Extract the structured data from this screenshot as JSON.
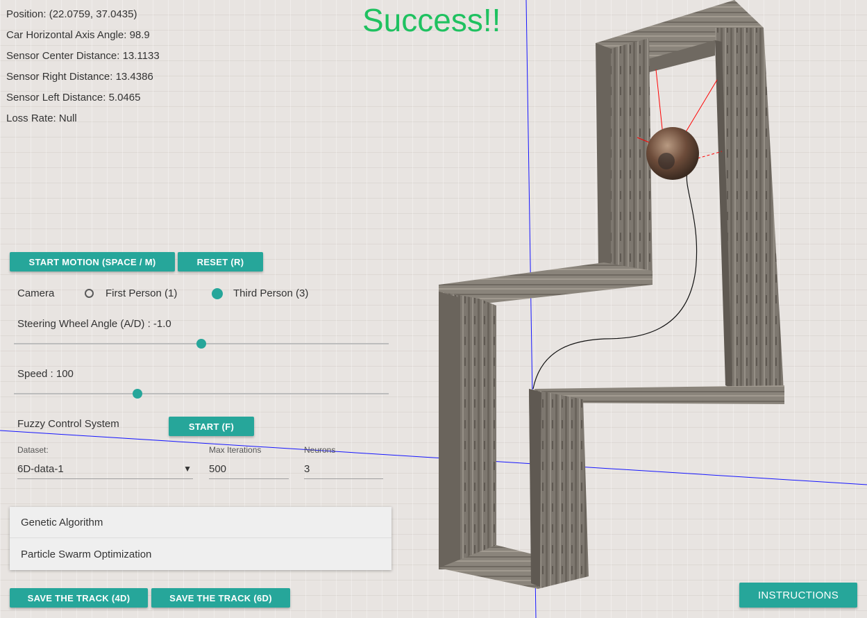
{
  "info": {
    "position": "Position: (22.0759, 37.0435)",
    "angle": "Car Horizontal Axis Angle: 98.9",
    "sensor_center": "Sensor Center Distance: 13.1133",
    "sensor_right": "Sensor Right Distance: 13.4386",
    "sensor_left": "Sensor Left Distance: 5.0465",
    "loss_rate": "Loss Rate: Null"
  },
  "status": "Success!!",
  "controls": {
    "start_motion": "START MOTION (SPACE / M)",
    "reset": "RESET (R)",
    "camera_label": "Camera",
    "camera_first": "First Person (1)",
    "camera_third": "Third Person (3)",
    "steering_label": "Steering Wheel Angle (A/D) : -1.0",
    "steering_level": 0.5,
    "speed_label": "Speed : 100",
    "speed_level": 0.33,
    "fuzzy_label": "Fuzzy Control System",
    "fuzzy_start": "START (F)",
    "dataset_label": "Dataset:",
    "dataset_value": "6D-data-1",
    "max_iter_label": "Max Iterations",
    "max_iter_value": "500",
    "neurons_label": "Neurons",
    "neurons_value": "3"
  },
  "algorithms": [
    "Genetic Algorithm",
    "Particle Swarm Optimization"
  ],
  "footer": {
    "save4d": "SAVE THE TRACK (4D)",
    "save6d": "SAVE THE TRACK (6D)",
    "instructions": "INSTRUCTIONS"
  },
  "colors": {
    "accent": "#26a69a",
    "success": "#1fc160",
    "axis": "#1414ff",
    "sensor_ray": "#ff0000",
    "wall": "#7d776f"
  }
}
